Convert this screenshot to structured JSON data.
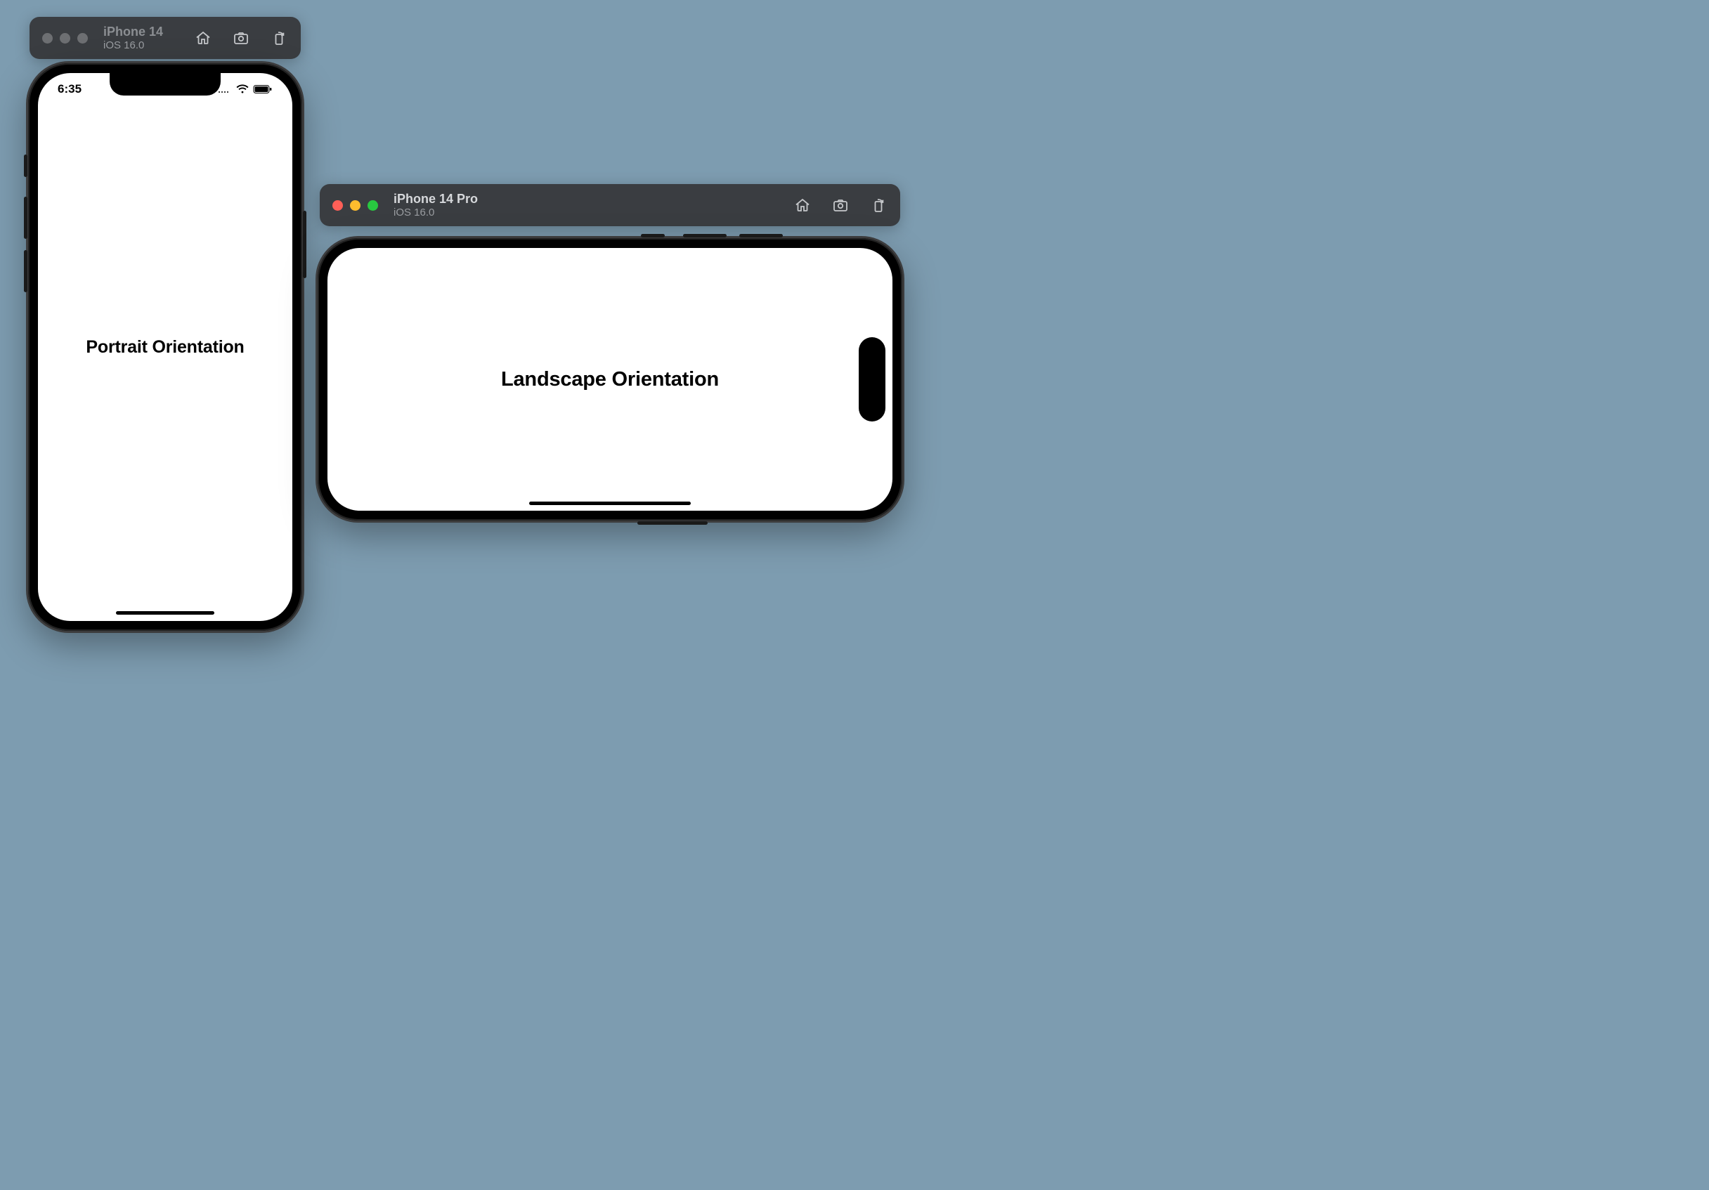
{
  "simulators": {
    "portrait": {
      "device": "iPhone 14",
      "os": "iOS 16.0",
      "active": false,
      "status_time": "6:35",
      "app_label": "Portrait Orientation"
    },
    "landscape": {
      "device": "iPhone 14 Pro",
      "os": "iOS 16.0",
      "active": true,
      "app_label": "Landscape Orientation"
    }
  },
  "toolbar_icons": {
    "home": "home-icon",
    "screenshot": "screenshot-icon",
    "rotate": "rotate-icon"
  }
}
